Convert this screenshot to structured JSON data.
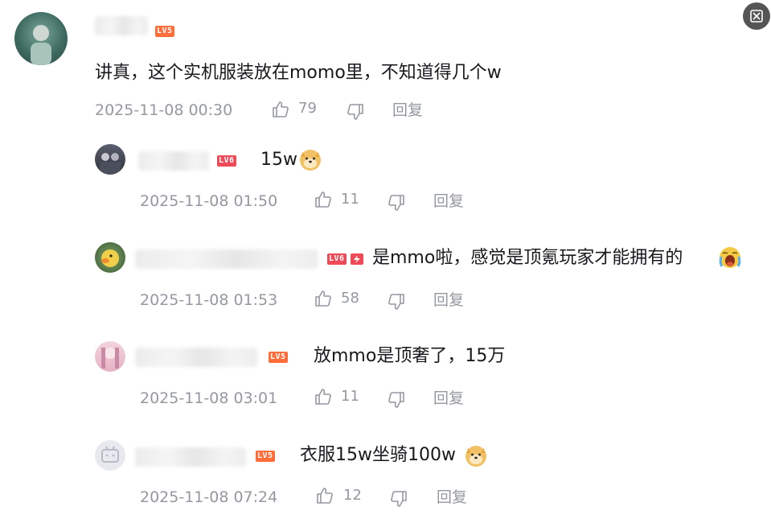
{
  "comments": [
    {
      "level": "LV5",
      "text": "讲真，这个实机服装放在momo里，不知道得几个w",
      "time": "2025-11-08 00:30",
      "likes": "79",
      "reply_label": "回复"
    },
    {
      "level": "LV6",
      "text": "15w",
      "time": "2025-11-08 01:50",
      "likes": "11",
      "reply_label": "回复"
    },
    {
      "level": "LV6",
      "text": "是mmo啦，感觉是顶氪玩家才能拥有的",
      "time": "2025-11-08 01:53",
      "likes": "58",
      "reply_label": "回复"
    },
    {
      "level": "LV5",
      "text": "放mmo是顶奢了，15万",
      "time": "2025-11-08 03:01",
      "likes": "11",
      "reply_label": "回复"
    },
    {
      "level": "LV5",
      "text": "衣服15w坐骑100w",
      "time": "2025-11-08 07:24",
      "likes": "12",
      "reply_label": "回复"
    }
  ],
  "colors": {
    "lv5": "#ff6d3b",
    "lv6": "#ee4a57",
    "meta": "#9499a0",
    "text": "#18191c"
  },
  "icons": [
    "close-overlay-icon",
    "thumbs-up-icon",
    "thumbs-down-icon",
    "doge-emoji",
    "crying-emoji",
    "lightning-icon"
  ]
}
